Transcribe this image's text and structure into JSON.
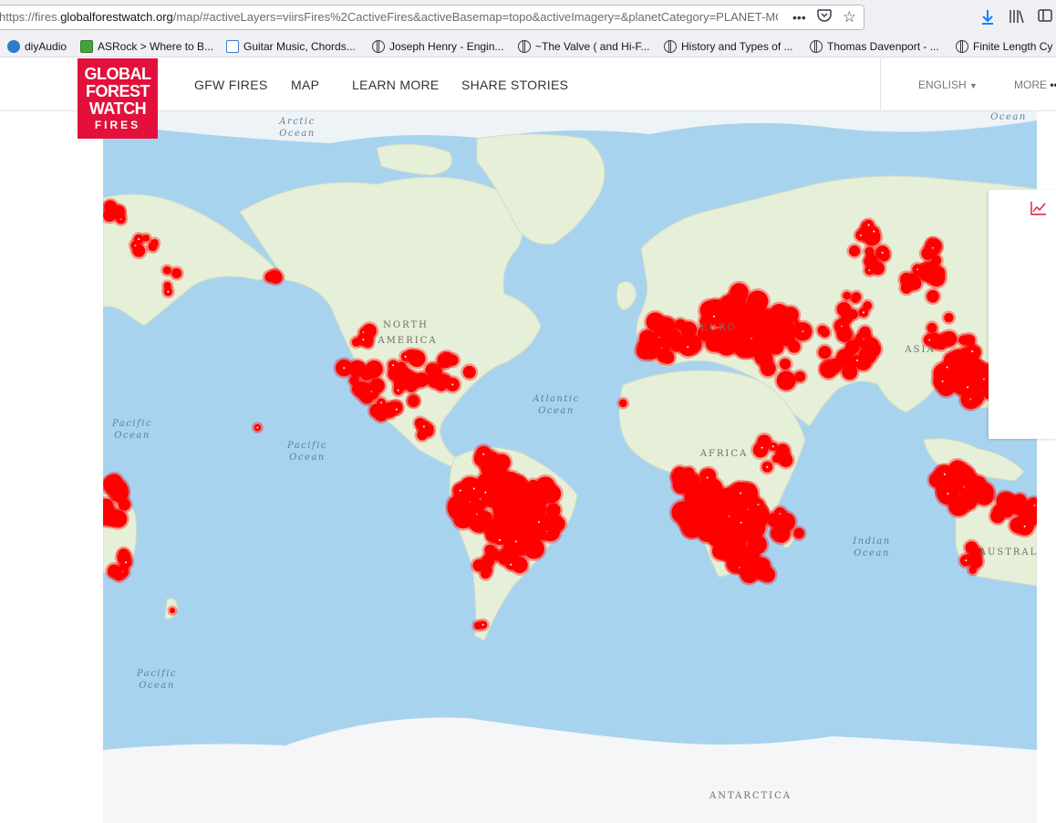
{
  "browser": {
    "url_prefix": "https://fires.",
    "url_host": "globalforestwatch.org",
    "url_rest": "/map/#activeLayers=viirsFires%2CactiveFires&activeBasemap=topo&activeImagery=&planetCategory=PLANET-MO",
    "bookmarks": [
      {
        "label": "diyAudio",
        "icon": "diyaudio-icon"
      },
      {
        "label": "ASRock > Where to B...",
        "icon": "asrock-icon"
      },
      {
        "label": "Guitar Music, Chords...",
        "icon": "page-icon"
      },
      {
        "label": "Joseph Henry - Engin...",
        "icon": "globe-icon"
      },
      {
        "label": "~The Valve ( and Hi-F...",
        "icon": "globe-icon"
      },
      {
        "label": "History and Types of ...",
        "icon": "globe-icon"
      },
      {
        "label": "Thomas Davenport - ...",
        "icon": "globe-icon"
      },
      {
        "label": "Finite Length Cy",
        "icon": "globe-icon"
      }
    ]
  },
  "header": {
    "logo": {
      "line1": "GLOBAL",
      "line2": "FOREST",
      "line3": "WATCH",
      "line4": "FIRES"
    },
    "nav": [
      "GFW FIRES",
      "MAP",
      "LEARN MORE",
      "SHARE STORIES"
    ],
    "language": "ENGLISH",
    "more": "MORE"
  },
  "map": {
    "ocean_labels": [
      {
        "line1": "Arctic",
        "line2": "Ocean"
      },
      {
        "line1": "Pacific",
        "line2": "Ocean"
      },
      {
        "line1": "Pacific",
        "line2": "Ocean"
      },
      {
        "line1": "Atlantic",
        "line2": "Ocean"
      },
      {
        "line1": "Indian",
        "line2": "Ocean"
      },
      {
        "line1": "Pacific",
        "line2": "Ocean"
      },
      {
        "line1": "Ocean",
        "line2": ""
      }
    ],
    "land_labels": [
      "NORTH",
      "AMERICA",
      "EURO",
      "ASIA",
      "AFRICA",
      "AUSTRAL",
      "ANTARCTICA"
    ],
    "colors": {
      "ocean": "#a8d3ef",
      "land": "#e6efd7",
      "fire": "#ff0000",
      "ice": "#f4f6f7"
    }
  }
}
